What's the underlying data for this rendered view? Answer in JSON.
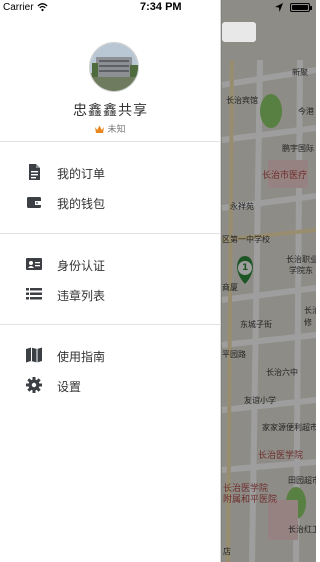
{
  "status_bar": {
    "carrier": "Carrier",
    "time": "7:34 PM"
  },
  "drawer": {
    "username": "忠鑫鑫共享",
    "level": "未知",
    "groups": [
      {
        "items": [
          {
            "label": "我的订单",
            "icon": "document-icon"
          },
          {
            "label": "我的钱包",
            "icon": "wallet-icon"
          }
        ]
      },
      {
        "items": [
          {
            "label": "身份认证",
            "icon": "id-card-icon"
          },
          {
            "label": "违章列表",
            "icon": "list-icon"
          }
        ]
      },
      {
        "items": [
          {
            "label": "使用指南",
            "icon": "map-guide-icon"
          },
          {
            "label": "设置",
            "icon": "gear-icon"
          }
        ]
      }
    ]
  },
  "map": {
    "labels": [
      "新聚",
      "长治宾馆",
      "今港",
      "鹏宇国际",
      "长治市医疗",
      "永祥苑",
      "区第一中学校",
      "长治职业",
      "学院东",
      "商厦",
      "长治",
      "修",
      "东城子街",
      "平园路",
      "长治六中",
      "友谊小学",
      "家家源便利超市",
      "长治医学院",
      "田园超市",
      "长治医学院",
      "附属和平医院",
      "长治红卫",
      "店"
    ],
    "marker_number": "1",
    "accent_color": "#2e8b3a"
  }
}
